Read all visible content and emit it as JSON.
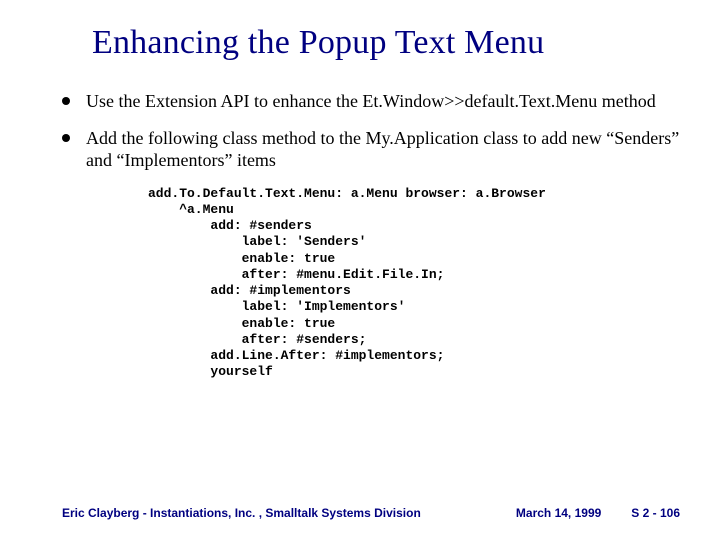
{
  "title": "Enhancing the Popup Text Menu",
  "bullets": [
    "Use the Extension API to enhance the Et.Window>>default.Text.Menu method",
    "Add the following class method to the My.Application class to add new “Senders” and “Implementors” items"
  ],
  "code": "add.To.Default.Text.Menu: a.Menu browser: a.Browser\n    ^a.Menu\n        add: #senders\n            label: 'Senders'\n            enable: true\n            after: #menu.Edit.File.In;\n        add: #implementors\n            label: 'Implementors'\n            enable: true\n            after: #senders;\n        add.Line.After: #implementors;\n        yourself",
  "footer": {
    "left": "Eric Clayberg - Instantiations, Inc. , Smalltalk Systems Division",
    "center": "March 14, 1999",
    "right": "S 2 - 106"
  }
}
